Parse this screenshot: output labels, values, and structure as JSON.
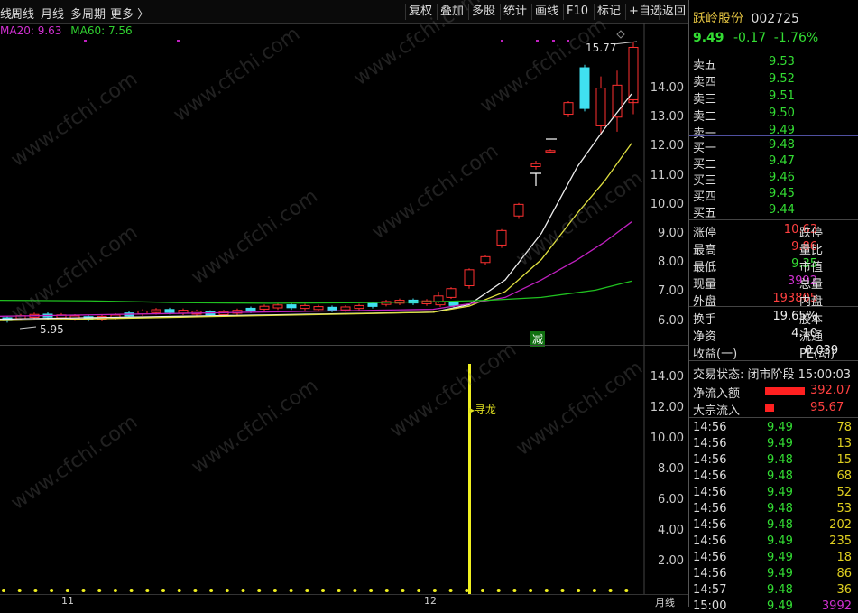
{
  "toolbar": {
    "left_items": [
      "线",
      "周线",
      "月线",
      "多周期",
      "更多 〉"
    ],
    "buttons": [
      "复权",
      "叠加",
      "多股",
      "统计",
      "画线",
      "F10",
      "标记",
      "+自选",
      "返回"
    ]
  },
  "ma_legend": {
    "ma20": "MA20: 9.63",
    "ma60": "MA60: 7.56"
  },
  "stock": {
    "name": "跃岭股份",
    "code": "002725",
    "price": "9.49",
    "change": "-0.17",
    "change_pct": "-1.76%"
  },
  "order_book": {
    "asks": [
      {
        "label": "卖五",
        "price": "9.53"
      },
      {
        "label": "卖四",
        "price": "9.52"
      },
      {
        "label": "卖三",
        "price": "9.51"
      },
      {
        "label": "卖二",
        "price": "9.50"
      },
      {
        "label": "卖一",
        "price": "9.49"
      }
    ],
    "bids": [
      {
        "label": "买一",
        "price": "9.48"
      },
      {
        "label": "买二",
        "price": "9.47"
      },
      {
        "label": "买三",
        "price": "9.46"
      },
      {
        "label": "买四",
        "price": "9.45"
      },
      {
        "label": "买五",
        "price": "9.44"
      }
    ]
  },
  "stats": [
    {
      "l1": "涨停",
      "v1": "10.63",
      "l2": "跌停"
    },
    {
      "l1": "最高",
      "v1": "9.86",
      "l2": "量比"
    },
    {
      "l1": "最低",
      "v1": "9.35",
      "l2": "市值"
    },
    {
      "l1": "现量",
      "v1": "3992",
      "l2": "总量"
    },
    {
      "l1": "外盘",
      "v1": "193805",
      "l2": "内盘"
    }
  ],
  "stats2": [
    {
      "l1": "换手",
      "v1": "19.65%",
      "l2": "股本"
    },
    {
      "l1": "净资",
      "v1": "4.10",
      "l2": "流通"
    },
    {
      "l1": "收益(一)",
      "v1": "0.039",
      "l2": "PE(动)"
    }
  ],
  "status": {
    "label": "交易状态: 闭市阶段 15:00:03"
  },
  "flows": [
    {
      "label": "净流入额",
      "value": "392.07"
    },
    {
      "label": "大宗流入",
      "value": "95.67"
    }
  ],
  "ticks": [
    {
      "t": "14:56",
      "p": "9.49",
      "v": "78"
    },
    {
      "t": "14:56",
      "p": "9.49",
      "v": "13"
    },
    {
      "t": "14:56",
      "p": "9.48",
      "v": "15"
    },
    {
      "t": "14:56",
      "p": "9.48",
      "v": "68"
    },
    {
      "t": "14:56",
      "p": "9.49",
      "v": "52"
    },
    {
      "t": "14:56",
      "p": "9.48",
      "v": "53"
    },
    {
      "t": "14:56",
      "p": "9.48",
      "v": "202"
    },
    {
      "t": "14:56",
      "p": "9.49",
      "v": "235"
    },
    {
      "t": "14:56",
      "p": "9.49",
      "v": "18"
    },
    {
      "t": "14:56",
      "p": "9.49",
      "v": "86"
    },
    {
      "t": "14:57",
      "p": "9.48",
      "v": "36"
    },
    {
      "t": "15:00",
      "p": "9.49",
      "v": "3992"
    }
  ],
  "main_axis": [
    "14.00",
    "13.00",
    "12.00",
    "11.00",
    "10.00",
    "9.00",
    "8.00",
    "7.00",
    "6.00"
  ],
  "sub_axis": [
    "14.00",
    "12.00",
    "10.00",
    "8.00",
    "6.00",
    "4.00",
    "2.00"
  ],
  "annotations": {
    "high": "15.77",
    "low": "5.95",
    "jian": "减",
    "signal": "寻龙"
  },
  "dates": {
    "d1": "11",
    "d2": "12",
    "period": "月线"
  },
  "watermark": "www.cfchi.com",
  "colors": {
    "up": "#ff3030",
    "down": "#40e0f0",
    "ma_white": "#eeeeee",
    "ma_yellow": "#e0e040",
    "ma_purple": "#c020c0",
    "ma_green": "#20c020"
  }
}
